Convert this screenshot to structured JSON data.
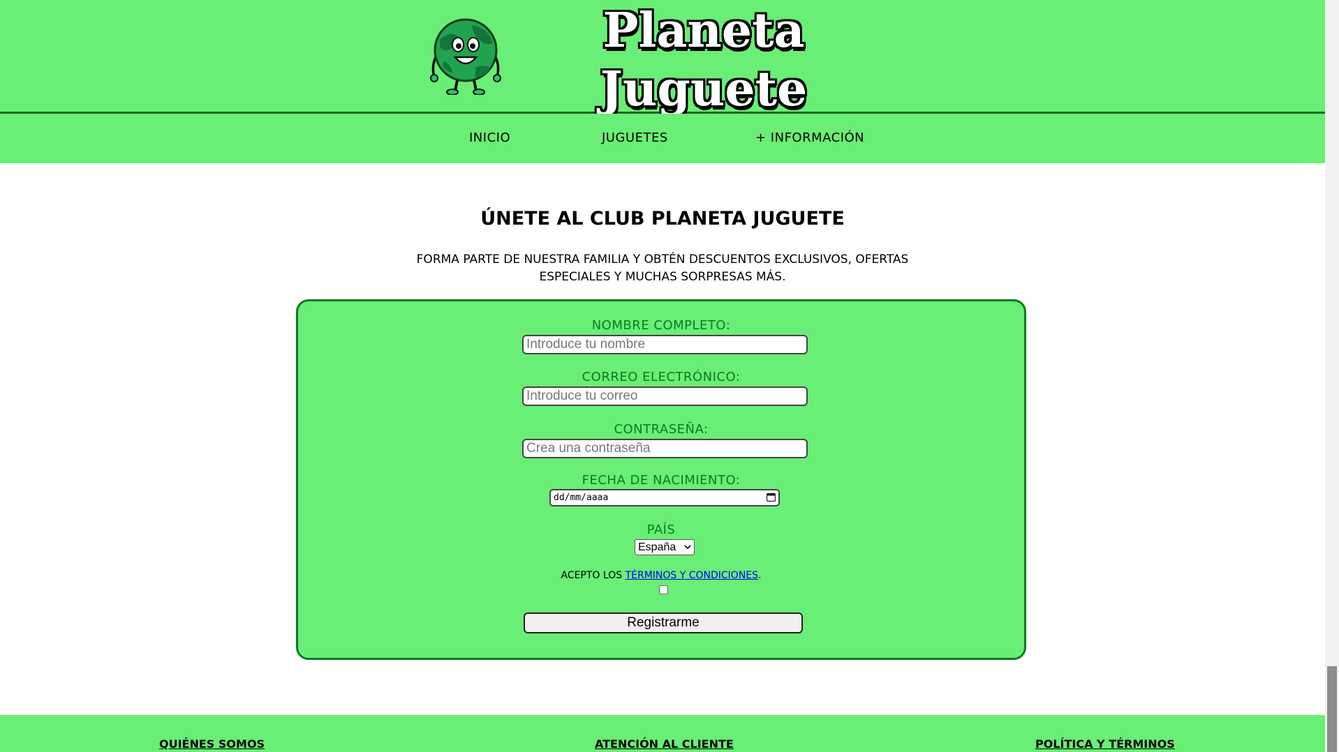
{
  "header": {
    "logo_line1": "Planeta",
    "logo_line2": "Juguete"
  },
  "nav": {
    "items": [
      "INICIO",
      "JUGUETES",
      "+ INFORMACIÓN"
    ]
  },
  "main": {
    "title": "ÚNETE AL CLUB PLANETA JUGUETE",
    "subtitle": "FORMA PARTE DE NUESTRA FAMILIA Y OBTÉN DESCUENTOS EXCLUSIVOS, OFERTAS ESPECIALES Y MUCHAS SORPRESAS MÁS."
  },
  "form": {
    "name_label": "NOMBRE COMPLETO:",
    "name_placeholder": "Introduce tu nombre",
    "email_label": "CORREO ELECTRÓNICO:",
    "email_placeholder": "Introduce tu correo",
    "password_label": "CONTRASEÑA:",
    "password_placeholder": "Crea una contraseña",
    "birthdate_label": "FECHA DE NACIMIENTO:",
    "birthdate_value": "dd/mm/aaaa",
    "country_label": "PAÍS",
    "country_value": "España",
    "terms_prefix": "ACEPTO LOS ",
    "terms_link": "TÉRMINOS Y CONDICIONES",
    "terms_suffix": ".",
    "submit_label": "Registrarme"
  },
  "footer": {
    "links": [
      "QUIÉNES SOMOS",
      "ATENCIÓN AL CLIENTE",
      "POLÍTICA Y TÉRMINOS"
    ]
  },
  "colors": {
    "brand_green": "#69ee76",
    "dark_green": "#0d7a22",
    "link_blue": "#0000ee"
  }
}
